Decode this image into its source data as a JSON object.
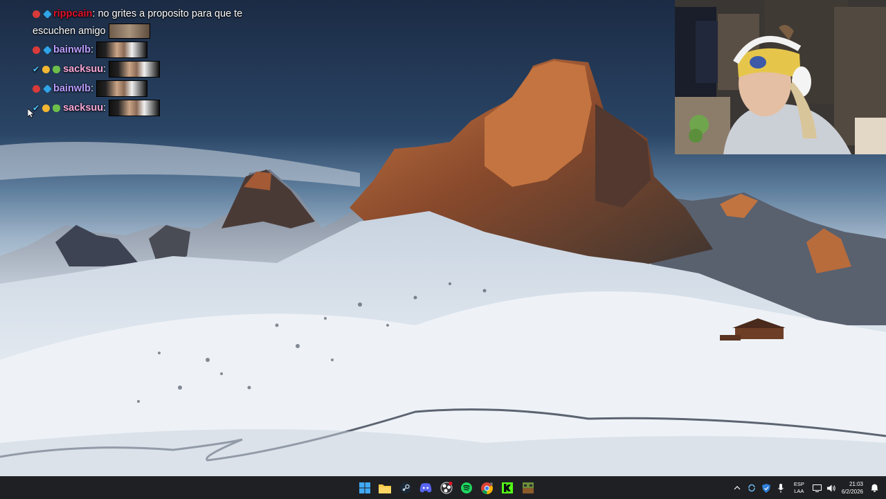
{
  "chat": {
    "messages": [
      {
        "user": "rippcain",
        "sep": ":",
        "text": "no grites a proposito para que te",
        "text2": "escuchen amigo",
        "user_color": "#e0102a",
        "badges": [
          "red-circle",
          "blue-gem"
        ]
      },
      {
        "user": "bainwlb",
        "sep": ":",
        "user_color": "#b99cff",
        "badges": [
          "red-circle",
          "blue-gem"
        ]
      },
      {
        "user": "sacksuu",
        "sep": ":",
        "user_color": "#f7a8d8",
        "badges": [
          "checkmark",
          "gold-coin",
          "frog"
        ]
      },
      {
        "user": "bainwlb",
        "sep": ":",
        "user_color": "#b99cff",
        "badges": [
          "red-circle",
          "blue-gem"
        ]
      },
      {
        "user": "sacksuu",
        "sep": ":",
        "user_color": "#f7a8d8",
        "badges": [
          "checkmark",
          "gold-coin",
          "frog"
        ]
      }
    ]
  },
  "taskbar": {
    "apps": [
      "windows-start-icon",
      "file-explorer-icon",
      "steam-icon",
      "discord-icon",
      "obs-icon",
      "spotify-icon",
      "chrome-icon",
      "kick-icon",
      "minecraft-icon"
    ],
    "tray": {
      "language_top": "ESP",
      "language_bottom": "LAA",
      "time": "21:03",
      "date": "6/2/2026"
    }
  },
  "colors": {
    "taskbar": "#1f2023",
    "accent": "#0078d4"
  }
}
